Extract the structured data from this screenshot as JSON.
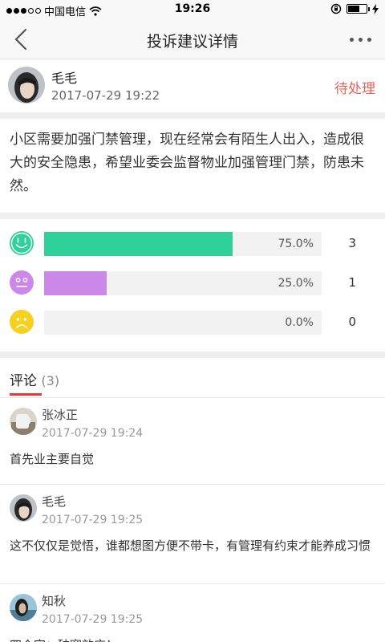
{
  "status_bar": {
    "carrier": "中国电信",
    "time": "19:26"
  },
  "nav": {
    "title": "投诉建议详情"
  },
  "post": {
    "author": "毛毛",
    "time": "2017-07-29 19:22",
    "status": "待处理",
    "status_color": "#e8625a",
    "content": "小区需要加强门禁管理，现在经常会有陌生人出入，造成很大的安全隐患，希望业委会监督物业加强管理门禁，防患未然。"
  },
  "votes": [
    {
      "face": "happy-face-icon",
      "color": "#2dd199",
      "fraction": 0.75,
      "percent": "75.0%",
      "count": "3"
    },
    {
      "face": "neutral-face-icon",
      "color": "#cc88e8",
      "fraction": 0.25,
      "percent": "25.0%",
      "count": "1"
    },
    {
      "face": "sad-face-icon",
      "color": "#f7d11f",
      "fraction": 0.0,
      "percent": "0.0%",
      "count": "0"
    }
  ],
  "comments": {
    "title": "评论",
    "count": "(3)",
    "accent": "#e53935",
    "items": [
      {
        "name": "张冰正",
        "time": "2017-07-29 19:24",
        "text": "首先业主要自觉"
      },
      {
        "name": "毛毛",
        "time": "2017-07-29 19:25",
        "text": "这不仅仅是觉悟，谁都想图方便不带卡，有管理有约束才能养成习惯"
      },
      {
        "name": "知秋",
        "time": "2017-07-29 19:25",
        "text": "四个字：破窗效应！"
      }
    ]
  }
}
